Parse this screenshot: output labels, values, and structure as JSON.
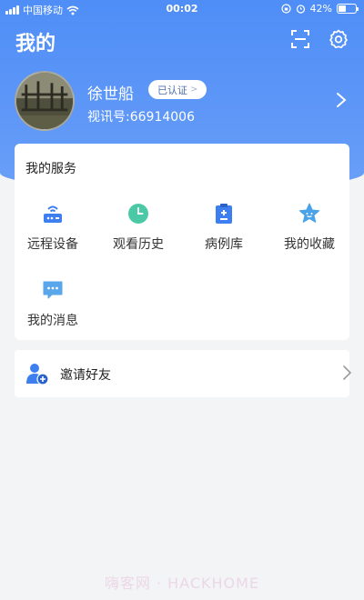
{
  "status_bar": {
    "carrier": "中国移动",
    "time": "00:02",
    "battery": "42%",
    "battery_level": 0.42
  },
  "header": {
    "title": "我的"
  },
  "profile": {
    "name": "徐世船",
    "badge": "已认证",
    "id_text": "视讯号:66914006"
  },
  "services": {
    "title": "我的服务",
    "items": [
      {
        "label": "远程设备",
        "icon": "remote-device-icon"
      },
      {
        "label": "观看历史",
        "icon": "clock-icon"
      },
      {
        "label": "病例库",
        "icon": "clipboard-icon"
      },
      {
        "label": "我的收藏",
        "icon": "star-icon"
      },
      {
        "label": "我的消息",
        "icon": "message-icon"
      }
    ]
  },
  "invite": {
    "label": "邀请好友",
    "icon": "add-user-icon"
  },
  "colors": {
    "accent": "#4f8ef7",
    "icon_blue": "#3d7ff0",
    "icon_teal": "#4bc9a6",
    "background": "#f3f4f6"
  },
  "watermark": "嗨客网 · HACKHOME"
}
